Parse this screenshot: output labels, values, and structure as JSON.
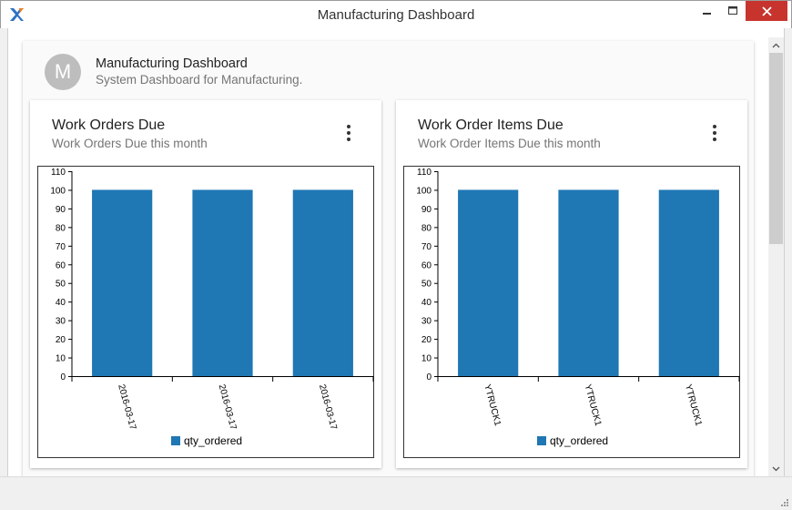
{
  "window": {
    "title": "Manufacturing Dashboard"
  },
  "dashboard": {
    "avatar_letter": "M",
    "title": "Manufacturing Dashboard",
    "subtitle": "System Dashboard for Manufacturing."
  },
  "panels": [
    {
      "title": "Work Orders Due",
      "subtitle": "Work Orders Due this month"
    },
    {
      "title": "Work Order Items Due",
      "subtitle": "Work Order Items Due this month"
    }
  ],
  "colors": {
    "bar": "#1f77b4",
    "close": "#c7342e"
  },
  "chart_data": [
    {
      "type": "bar",
      "categories": [
        "2016-03-17",
        "2016-03-17",
        "2016-03-17"
      ],
      "series": [
        {
          "name": "qty_ordered",
          "values": [
            100,
            100,
            100
          ]
        }
      ],
      "ylim": [
        0,
        110
      ],
      "yticks": [
        0,
        10,
        20,
        30,
        40,
        50,
        60,
        70,
        80,
        90,
        100,
        110
      ],
      "legend": "bottom-center",
      "grid": false
    },
    {
      "type": "bar",
      "categories": [
        "YTRUCK1",
        "YTRUCK1",
        "YTRUCK1"
      ],
      "series": [
        {
          "name": "qty_ordered",
          "values": [
            100,
            100,
            100
          ]
        }
      ],
      "ylim": [
        0,
        110
      ],
      "yticks": [
        0,
        10,
        20,
        30,
        40,
        50,
        60,
        70,
        80,
        90,
        100,
        110
      ],
      "legend": "bottom-center",
      "grid": false
    }
  ]
}
